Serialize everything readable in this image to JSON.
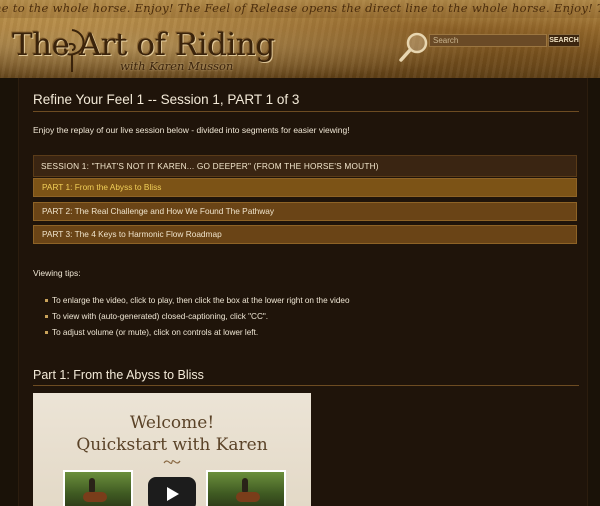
{
  "header": {
    "tagline": "ne to the whole horse. Enjoy!  The Feel of Release opens the direct line to the whole horse. Enjoy!  The Feel of Release opens the direct l",
    "logo_title": "The Art of Riding",
    "logo_subtitle": "with Karen Musson",
    "search_placeholder": "Search",
    "search_button": "SEARCH"
  },
  "page": {
    "title": "Refine Your Feel 1 -- Session 1, PART 1 of 3",
    "intro": "Enjoy the replay of our live session below - divided into segments for easier viewing!"
  },
  "session": {
    "heading": "SESSION 1: \"THAT'S NOT IT KAREN... GO DEEPER\" (FROM THE HORSE'S MOUTH)",
    "parts": [
      "PART 1: From the Abyss to Bliss",
      "PART 2: The Real Challenge and How We Found The Pathway",
      "PART 3: The 4 Keys to Harmonic Flow Roadmap"
    ],
    "active_index": 0
  },
  "tips": {
    "heading": "Viewing tips:",
    "items": [
      "To enlarge the video, click to play, then click the box at the lower right on the video",
      "To view with (auto-generated) closed-captioning, click \"CC\".",
      "To adjust volume (or mute), click on controls at lower left."
    ]
  },
  "section": {
    "title": "Part 1: From the Abyss to Bliss"
  },
  "video": {
    "line1": "Welcome!",
    "line2": "Quickstart with Karen"
  },
  "colors": {
    "active_part_text": "#f1cf58",
    "part_bg": "#6a4416",
    "content_bg": "#1f140a"
  }
}
